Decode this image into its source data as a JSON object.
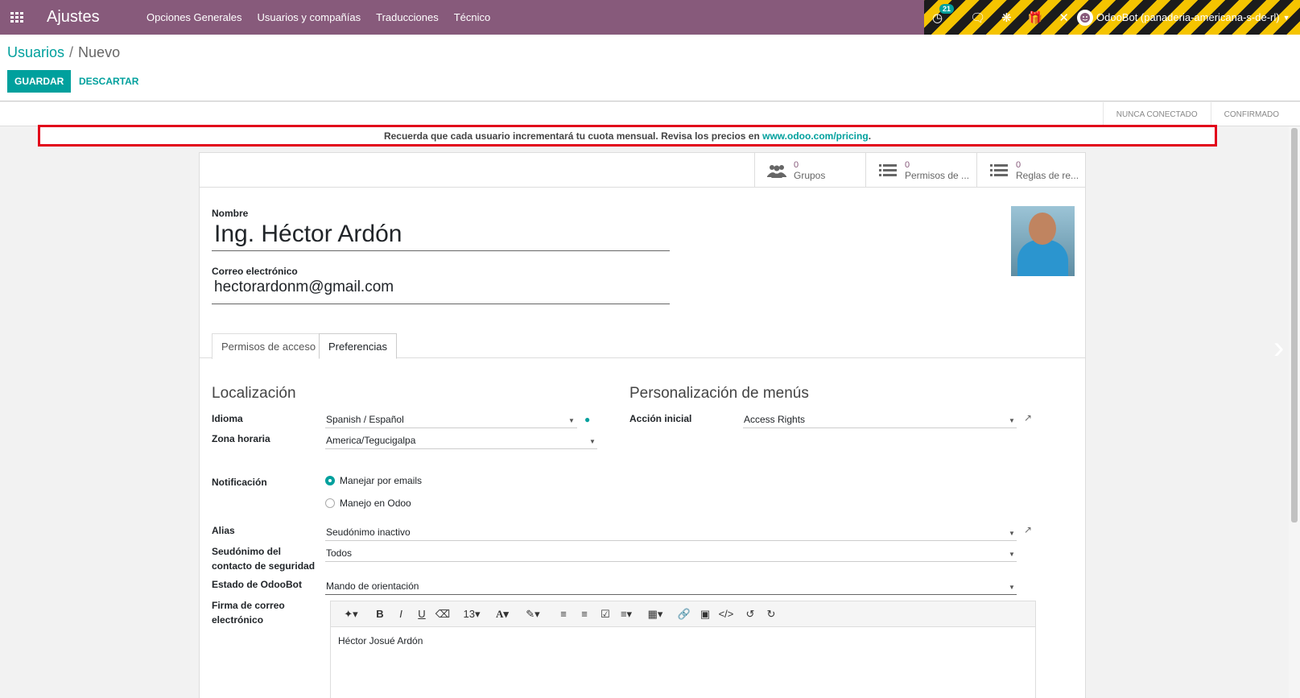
{
  "navbar": {
    "brand": "Ajustes",
    "menu": [
      "Opciones Generales",
      "Usuarios y compañías",
      "Traducciones",
      "Técnico"
    ],
    "activity_badge": "21",
    "user": "OdooBot (panaderia-americana-s-de-rl)"
  },
  "control_panel": {
    "breadcrumb_parent": "Usuarios",
    "breadcrumb_sep": "/",
    "breadcrumb_current": "Nuevo",
    "save_label": "GUARDAR",
    "discard_label": "DESCARTAR"
  },
  "statusbar": [
    "NUNCA CONECTADO",
    "CONFIRMADO"
  ],
  "alert": {
    "text": "Recuerda que cada usuario incrementará tu cuota mensual. Revisa los precios en ",
    "link": "www.odoo.com/pricing",
    "end": "."
  },
  "stat_buttons": [
    {
      "value": "0",
      "label": "Grupos",
      "icon": "users-icon"
    },
    {
      "value": "0",
      "label": "Permisos de ...",
      "icon": "list-icon"
    },
    {
      "value": "0",
      "label": "Reglas de re...",
      "icon": "list-icon"
    }
  ],
  "form": {
    "name_label": "Nombre",
    "name_value": "Ing. Héctor Ardón",
    "email_label": "Correo electrónico",
    "email_value": "hectorardonm@gmail.com"
  },
  "tabs": [
    "Permisos de acceso",
    "Preferencias"
  ],
  "preferences": {
    "localization_title": "Localización",
    "menu_title": "Personalización de menús",
    "idioma_label": "Idioma",
    "idioma_value": "Spanish / Español",
    "zona_label": "Zona horaria",
    "zona_value": "America/Tegucigalpa",
    "accion_label": "Acción inicial",
    "accion_value": "Access Rights",
    "notif_label": "Notificación",
    "notif_option1": "Manejar por emails",
    "notif_option2": "Manejo en Odoo",
    "alias_label": "Alias",
    "alias_value": "Seudónimo inactivo",
    "seudonimo_label": "Seudónimo del contacto de seguridad",
    "seudonimo_value": "Todos",
    "odoobot_label": "Estado de OdooBot",
    "odoobot_value": "Mando de orientación",
    "firma_label": "Firma de correo electrónico",
    "firma_value": "Héctor Josué Ardón",
    "font_size": "13"
  }
}
